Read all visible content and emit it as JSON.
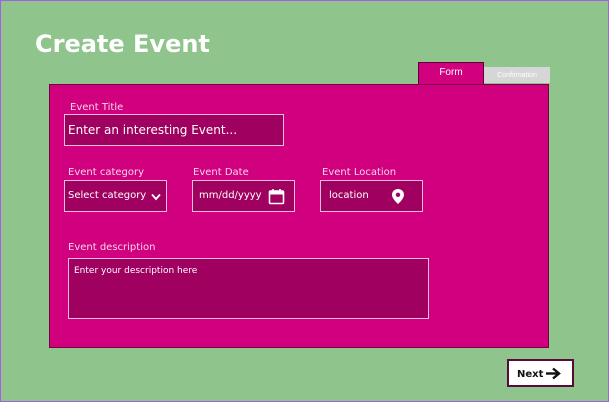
{
  "page": {
    "title": "Create Event"
  },
  "tabs": {
    "form": "Form",
    "confirmation": "Confirmation"
  },
  "form": {
    "event_title": {
      "label": "Event  Title",
      "placeholder": "Enter an interesting Event..."
    },
    "category": {
      "label": "Event  category",
      "value": "Select  category"
    },
    "date": {
      "label": "Event  Date",
      "placeholder": "mm/dd/yyyy"
    },
    "location": {
      "label": "Event  Location",
      "placeholder": "location"
    },
    "description": {
      "label": "Event  description",
      "placeholder": "Enter your description here"
    }
  },
  "actions": {
    "next": "Next"
  },
  "colors": {
    "background": "#8FC48C",
    "panel": "#D0007F",
    "input": "#A0005F",
    "tab_inactive": "#D6D6D6",
    "button_border": "#5A0A3A"
  },
  "icons": {
    "category": "chevron-down-icon",
    "date": "calendar-icon",
    "location": "location-pin-icon",
    "next": "arrow-right-icon"
  }
}
